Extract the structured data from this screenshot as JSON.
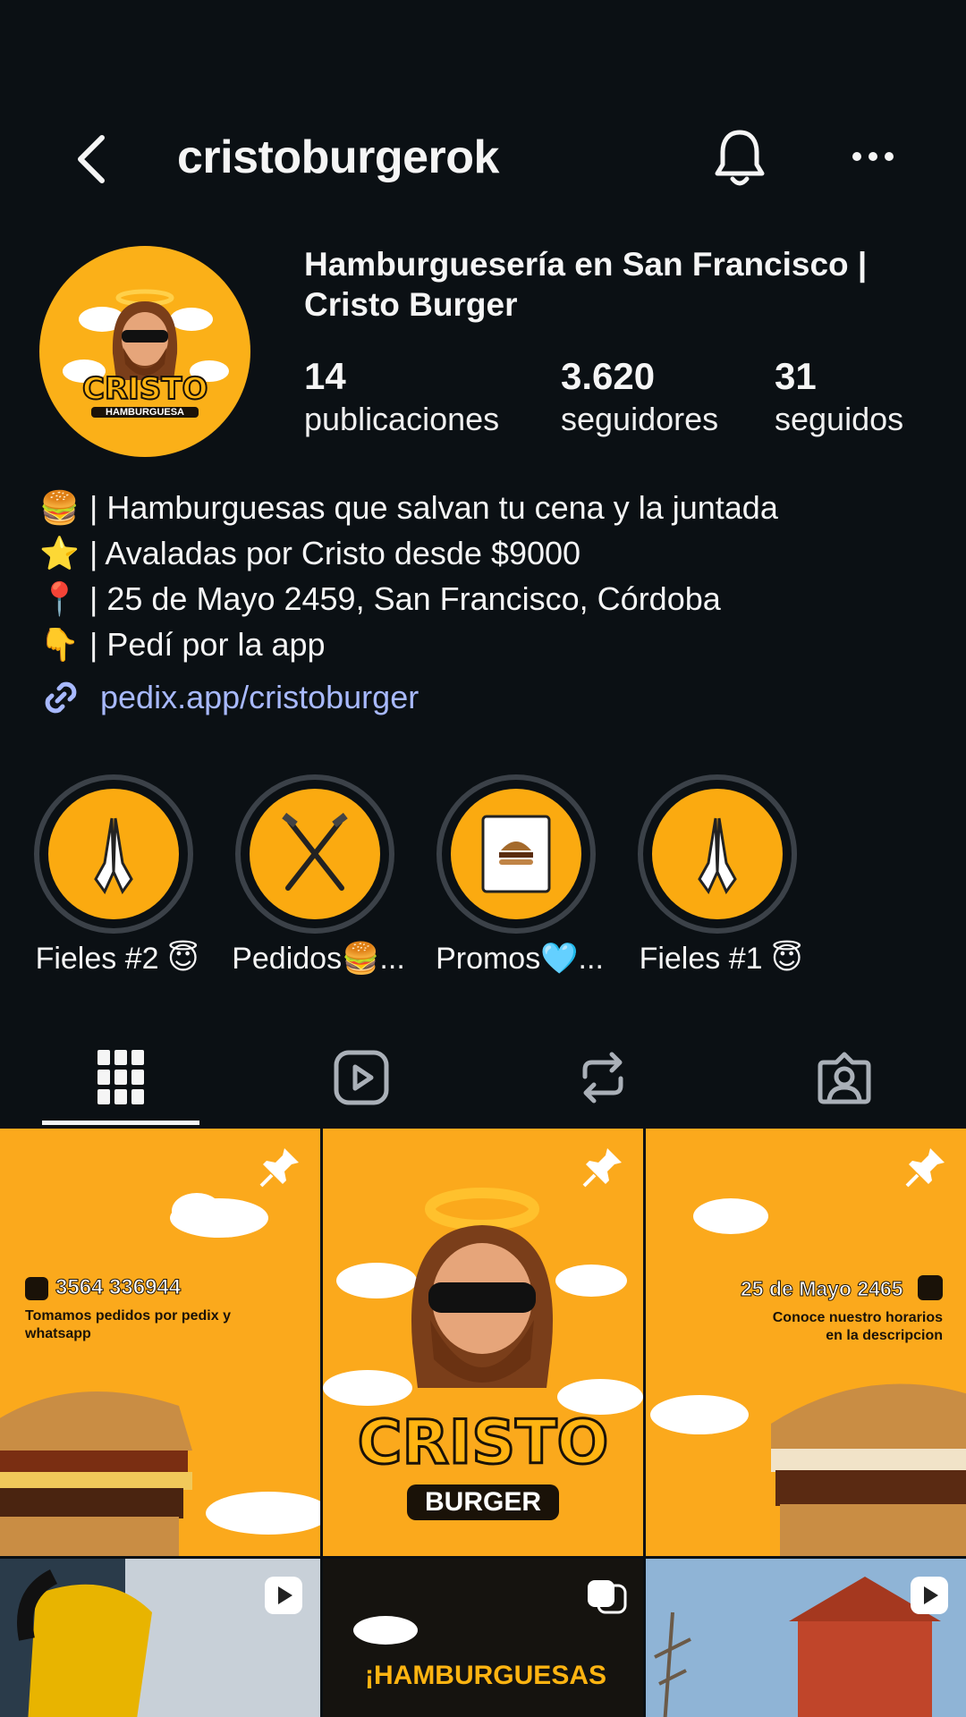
{
  "header": {
    "username": "cristoburgerok"
  },
  "profile": {
    "display_name": "Hamburguesería en San Francisco | Cristo Burger",
    "avatar_text": "CRISTO",
    "avatar_subtext": "HAMBURGUESA",
    "stats": {
      "posts": {
        "value": "14",
        "label": "publicaciones"
      },
      "followers": {
        "value": "3.620",
        "label": "seguidores"
      },
      "following": {
        "value": "31",
        "label": "seguidos"
      }
    }
  },
  "bio": {
    "lines": [
      {
        "emoji": "🍔",
        "text": "| Hamburguesas que salvan tu cena y la juntada"
      },
      {
        "emoji": "⭐",
        "text": "| Avaladas por Cristo desde $9000"
      },
      {
        "emoji": "📍",
        "text": "| 25 de Mayo 2459, San Francisco, Córdoba"
      },
      {
        "emoji": "👇",
        "text": "| Pedí por la app"
      }
    ],
    "link": "pedix.app/cristoburger"
  },
  "highlights": [
    {
      "label": "Fieles #2 😇",
      "icon": "praying-hands-icon"
    },
    {
      "label": "Pedidos🍔...",
      "icon": "crossed-nails-icon"
    },
    {
      "label": "Promos🩵...",
      "icon": "burger-book-icon"
    },
    {
      "label": "Fieles #1 😇",
      "icon": "praying-hands-icon"
    }
  ],
  "tabs": [
    "grid-icon",
    "reels-icon",
    "reposts-icon",
    "tagged-icon"
  ],
  "posts": [
    {
      "phone": "3564 336944",
      "caption": "Tomamos pedidos por pedix y whatsapp",
      "pinned": true
    },
    {
      "logo_top": "CRISTO",
      "logo_bottom": "BURGER",
      "pinned": true
    },
    {
      "address": "25 de Mayo 2465",
      "caption": "Conoce nuestro horarios en la descripcion",
      "pinned": true
    },
    {
      "type": "reel"
    },
    {
      "headline": "¡HAMBURGUESAS",
      "type": "reel"
    },
    {
      "type": "reel"
    }
  ],
  "colors": {
    "background": "#0b1014",
    "brand_orange": "#fbaa10",
    "link": "#a8b9ff",
    "ring": "#3b4148"
  }
}
